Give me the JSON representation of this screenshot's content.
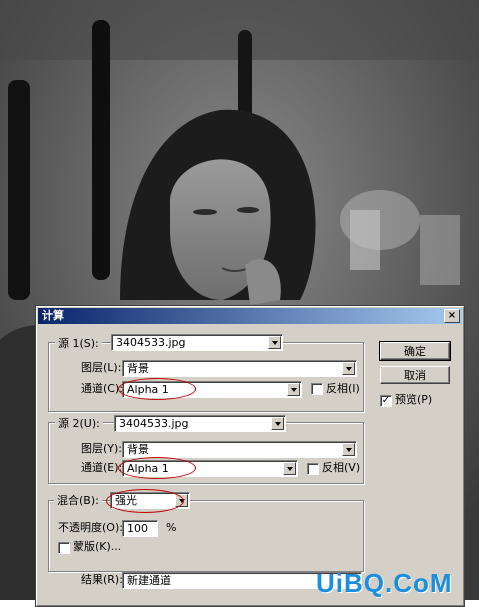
{
  "dialog": {
    "title": "计算",
    "close_glyph": "×",
    "source1": {
      "label": "源 1(S):",
      "file": "3404533.jpg",
      "layer_label": "图层(L):",
      "layer": "背景",
      "channel_label": "通道(C):",
      "channel": "Alpha 1",
      "invert_label": "反相(I)",
      "invert_checked": false
    },
    "source2": {
      "label": "源 2(U):",
      "file": "3404533.jpg",
      "layer_label": "图层(Y):",
      "layer": "背景",
      "channel_label": "通道(E):",
      "channel": "Alpha 1",
      "invert_label": "反相(V)",
      "invert_checked": false
    },
    "blend": {
      "label": "混合(B):",
      "mode": "强光",
      "opacity_label": "不透明度(O):",
      "opacity": "100",
      "opacity_unit": "%",
      "mask_label": "蒙版(K)...",
      "mask_checked": false
    },
    "result": {
      "label": "结果(R):",
      "value": "新建通道"
    },
    "buttons": {
      "ok": "确定",
      "cancel": "取消",
      "preview_label": "预览(P)",
      "preview_checked": true,
      "check_glyph": "✓"
    }
  },
  "watermark": "UiBQ.CoM",
  "colors": {
    "titlebar": "#0a246a",
    "dialog_bg": "#d4d0c8",
    "annotation": "#c00000"
  }
}
